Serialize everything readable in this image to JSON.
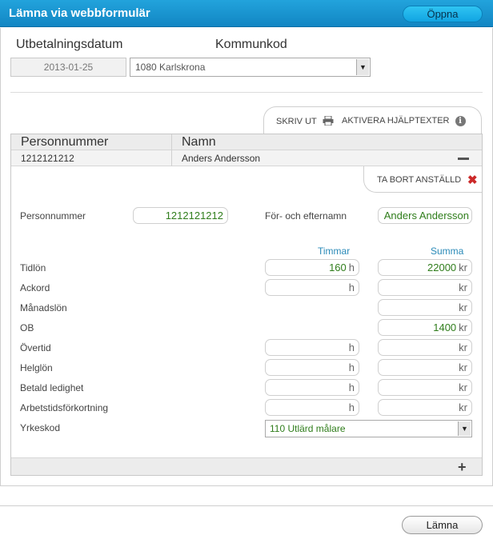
{
  "window": {
    "title": "Lämna via webbformulär",
    "open_button": "Öppna"
  },
  "header_fields": {
    "date_label": "Utbetalningsdatum",
    "date_value": "2013-01-25",
    "kommun_label": "Kommunkod",
    "kommun_value": "1080 Karlskrona"
  },
  "tabs": {
    "print": "SKRIV UT",
    "help": "AKTIVERA HJÄLPTEXTER"
  },
  "employee_table": {
    "columns": [
      "Personnummer",
      "Namn"
    ],
    "row": {
      "personnummer": "1212121212",
      "namn": "Anders Andersson"
    }
  },
  "employee_form": {
    "remove_label": "TA BORT ANSTÄLLD",
    "personnummer_label": "Personnummer",
    "personnummer_value": "1212121212",
    "name_label": "För- och efternamn",
    "name_value": "Anders Andersson",
    "col_hours": "Timmar",
    "col_sum": "Summa",
    "hour_unit": "h",
    "sum_unit": "kr",
    "rows": [
      {
        "label": "Tidlön",
        "hours": "160",
        "sum": "22000"
      },
      {
        "label": "Ackord",
        "hours": "",
        "sum": ""
      },
      {
        "label": "Månadslön",
        "sum": ""
      },
      {
        "label": "OB",
        "sum": "1400"
      },
      {
        "label": "Övertid",
        "hours": "",
        "sum": ""
      },
      {
        "label": "Helglön",
        "hours": "",
        "sum": ""
      },
      {
        "label": "Betald ledighet",
        "hours": "",
        "sum": ""
      },
      {
        "label": "Arbetstidsförkortning",
        "hours": "",
        "sum": ""
      }
    ],
    "yrkeskod_label": "Yrkeskod",
    "yrkeskod_value": "110 Utlärd målare"
  },
  "footer": {
    "submit_button": "Lämna"
  }
}
